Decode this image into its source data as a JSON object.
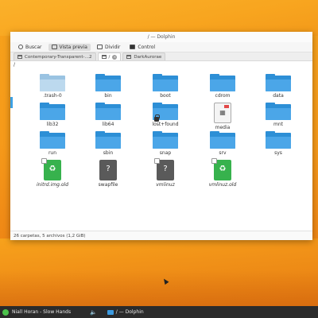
{
  "window": {
    "title": "/ — Dolphin"
  },
  "toolbar": {
    "buttons": [
      {
        "label": "Buscar",
        "icon": "search-icon"
      },
      {
        "label": "Vista previa",
        "icon": "preview-icon"
      },
      {
        "label": "Dividir",
        "icon": "split-icon"
      },
      {
        "label": "Control",
        "icon": "terminal-icon"
      }
    ]
  },
  "tabs": [
    {
      "label": "Contemporary-Transparent-…2"
    },
    {
      "label": "/"
    },
    {
      "label": "DarkAurorae"
    }
  ],
  "path": "/",
  "items": [
    {
      "name": ".trash-0",
      "type": "folder-dim"
    },
    {
      "name": "bin",
      "type": "folder"
    },
    {
      "name": "boot",
      "type": "folder"
    },
    {
      "name": "cdrom",
      "type": "folder"
    },
    {
      "name": "data",
      "type": "folder"
    },
    {
      "name": "lib32",
      "type": "folder"
    },
    {
      "name": "lib64",
      "type": "folder"
    },
    {
      "name": "lost+found",
      "type": "folder-locked"
    },
    {
      "name": "media",
      "type": "media"
    },
    {
      "name": "mnt",
      "type": "folder"
    },
    {
      "name": "run",
      "type": "folder"
    },
    {
      "name": "sbin",
      "type": "folder"
    },
    {
      "name": "snap",
      "type": "folder"
    },
    {
      "name": "srv",
      "type": "folder"
    },
    {
      "name": "sys",
      "type": "folder"
    },
    {
      "name": "initrd.img.old",
      "type": "file-green"
    },
    {
      "name": "swapfile",
      "type": "file-gray"
    },
    {
      "name": "vmlinuz",
      "type": "file-gray"
    },
    {
      "name": "vmlinuz.old",
      "type": "file-green"
    }
  ],
  "status": "26 carpetas, 5 archivos (1,2 GiB)",
  "taskbar": {
    "media": "Niall Horan - Slow Hands",
    "task": "/ — Dolphin"
  },
  "colors": {
    "folder": "#4ba6e8",
    "wallpaper": "#f69a1a",
    "taskbar": "#2b2b2b"
  }
}
